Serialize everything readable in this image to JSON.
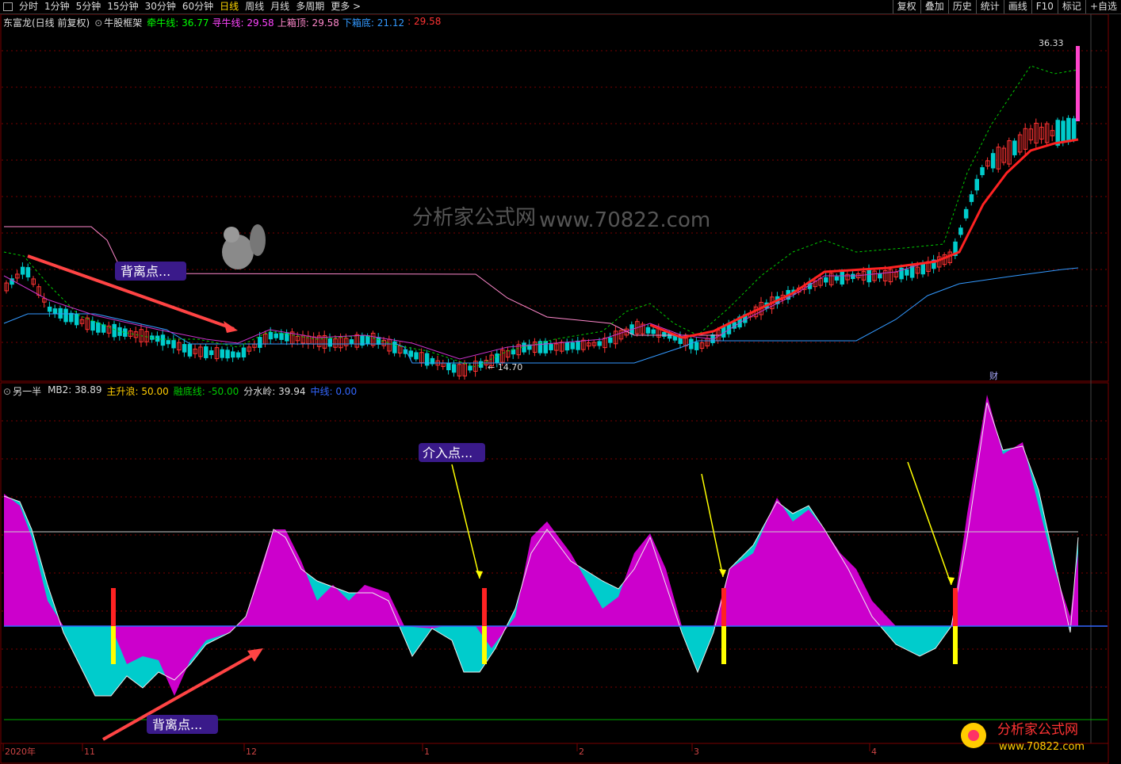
{
  "toolbar": {
    "tabs": [
      "分时",
      "1分钟",
      "5分钟",
      "15分钟",
      "30分钟",
      "60分钟",
      "日线",
      "周线",
      "月线",
      "多周期",
      "更多 >"
    ],
    "active_tab": "日线",
    "right_buttons": [
      "复权",
      "叠加",
      "历史",
      "统计",
      "画线",
      "F10",
      "标记",
      "+自选"
    ]
  },
  "main_legend": {
    "stock": "东富龙(日线 前复权)",
    "indicator": "牛股框架",
    "items": [
      {
        "label": "牵牛线:",
        "value": "36.77",
        "color": "#00ff00"
      },
      {
        "label": "寻牛线:",
        "value": "29.58",
        "color": "#ff44ff"
      },
      {
        "label": "上箱顶:",
        "value": "29.58",
        "color": "#ff88cc"
      },
      {
        "label": "下箱底:",
        "value": "21.12",
        "color": "#3399ff"
      },
      {
        "label": ":",
        "value": "29.58",
        "color": "#ff3333"
      }
    ]
  },
  "sub_legend": {
    "indicator": "另一半",
    "items": [
      {
        "label": "MB2:",
        "value": "38.89",
        "color": "#dddddd"
      },
      {
        "label": "主升浪:",
        "value": "50.00",
        "color": "#ffcc00"
      },
      {
        "label": "融底线:",
        "value": "-50.00",
        "color": "#00cc00"
      },
      {
        "label": "分水岭:",
        "value": "39.94",
        "color": "#dddddd"
      },
      {
        "label": "中线:",
        "value": "0.00",
        "color": "#3366ff"
      }
    ]
  },
  "annotations": {
    "divergence_top": "背离点...",
    "divergence_bottom": "背离点...",
    "entry": "介入点...",
    "high_label": "36.33",
    "low_label": "14.70",
    "cai_label": "财"
  },
  "watermark": {
    "text": "www.70822.com",
    "brand": "分析家公式网",
    "brand_url": "www.70822.com"
  },
  "time_axis": [
    "2020年",
    "11",
    "12",
    "1",
    "2",
    "3",
    "4"
  ],
  "colors": {
    "up": "#ff3333",
    "down": "#00cccc",
    "magenta": "#cc00cc",
    "cyan": "#00cccc",
    "grid": "#7a0000"
  }
}
